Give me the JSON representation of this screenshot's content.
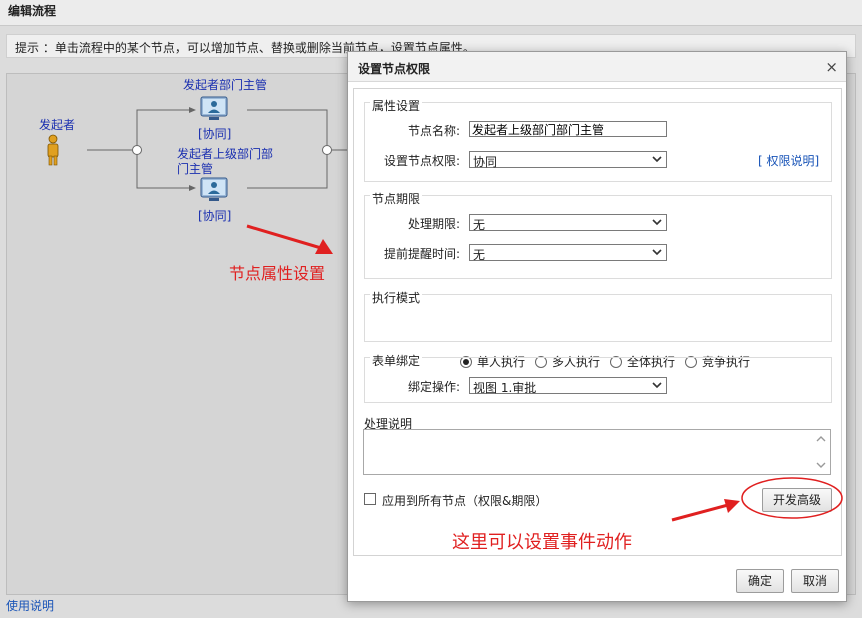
{
  "window": {
    "title": "编辑流程",
    "hint": "提示 ：单击流程中的某个节点，可以增加节点、替换或删除当前节点，设置节点属性。",
    "bottom_link": "使用说明"
  },
  "flow": {
    "initiator_label": "发起者",
    "node1_label": "发起者部门主管",
    "node1_tag": "[协同]",
    "node2_label_line1": "发起者上级部门部",
    "node2_label_line2": "门主管",
    "node2_tag": "[协同]"
  },
  "annotations": {
    "node_property": "节点属性设置",
    "event_action": "这里可以设置事件动作"
  },
  "dialog": {
    "title": "设置节点权限",
    "close_symbol": "×",
    "property": {
      "legend": "属性设置",
      "name_label": "节点名称:",
      "name_value": "发起者上级部门部门主管",
      "permission_label": "设置节点权限:",
      "permission_value": "协同",
      "permission_help": "[ 权限说明]"
    },
    "deadline": {
      "legend": "节点期限",
      "deadline_label": "处理期限:",
      "deadline_value": "无",
      "remind_label": "提前提醒时间:",
      "remind_value": "无"
    },
    "mode": {
      "legend": "执行模式",
      "options": [
        "单人执行",
        "多人执行",
        "全体执行",
        "竞争执行"
      ],
      "selected": "单人执行"
    },
    "form": {
      "legend": "表单绑定",
      "bind_label": "绑定操作:",
      "bind_value": "视图 1.审批"
    },
    "note_label": "处理说明",
    "apply_all_label": "应用到所有节点（权限&期限）",
    "advanced_button": "开发高级",
    "ok_button": "确定",
    "cancel_button": "取消"
  },
  "colors": {
    "node_text": "#1a2fb0",
    "annotation": "#e02020",
    "link": "#1a55b8"
  }
}
